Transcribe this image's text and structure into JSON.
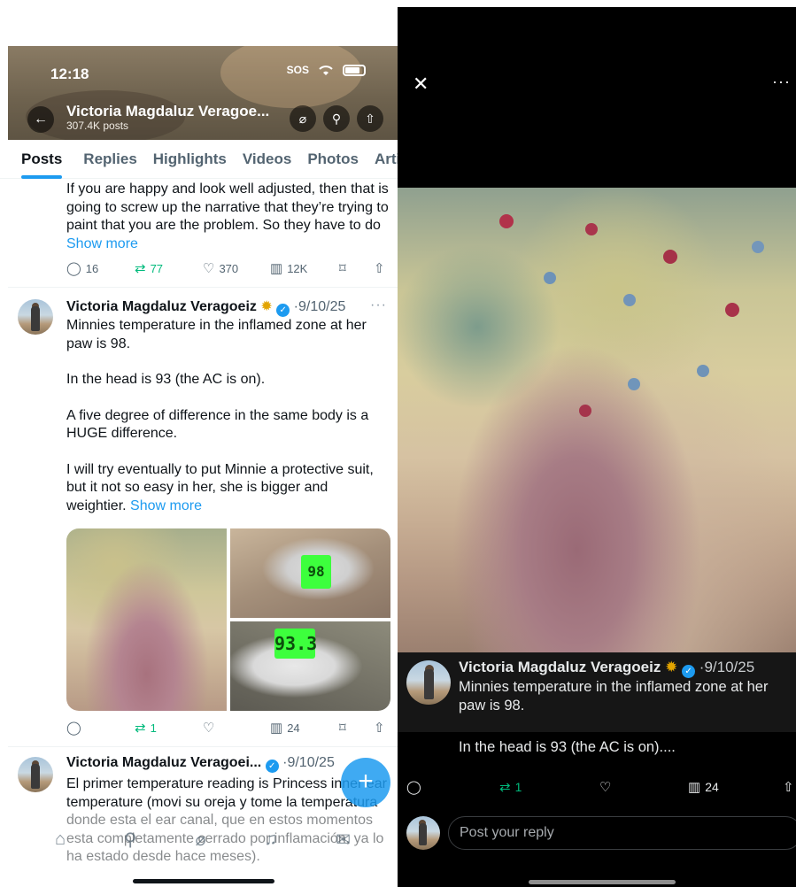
{
  "left": {
    "status": {
      "time": "12:18",
      "sos": "SOS"
    },
    "profile": {
      "name": "Victoria Magdaluz Veragoe...",
      "posts_count": "307.4K posts"
    },
    "tabs": [
      "Posts",
      "Replies",
      "Highlights",
      "Videos",
      "Photos",
      "Artic"
    ],
    "post1": {
      "text": "If you are happy and look well adjusted, then that is going to screw up the narrative that they’re trying to paint that you are the problem. So they have to do",
      "show_more": "Show more",
      "replies": "16",
      "reposts": "77",
      "likes": "370",
      "views": "12K"
    },
    "post2": {
      "name": "Victoria Magdaluz Veragoeiz",
      "date": "9/10/25",
      "p1": "Minnies temperature in the inflamed zone at her paw is 98.",
      "p2": "In the head is 93 (the AC is on).",
      "p3": "A five degree of difference in the same body is a HUGE difference.",
      "p4": "I will try eventually to put Minnie a protective suit, but it not so easy in her, she is bigger and weightier.",
      "show_more": "Show more",
      "lcd_top": "98",
      "lcd_bottom": "93.3",
      "reposts": "1",
      "views": "24"
    },
    "post3": {
      "name": "Victoria Magdaluz Veragoei...",
      "date": "9/10/25",
      "text": "El primer temperature reading is Princess inner ear temperature (movi su oreja y tome la temperatura donde esta el ear canal, que en estos momentos esta completamente cerrado por inflamación, ya lo ha estado desde hace meses)."
    }
  },
  "right": {
    "name": "Victoria Magdaluz Veragoeiz",
    "date": "9/10/25",
    "text1": "Minnies temperature in the inflamed zone at her paw is 98.",
    "text2": "In the head is 93 (the AC is on)....",
    "reposts": "1",
    "views": "24",
    "reply_placeholder": "Post your reply"
  },
  "colors": {
    "accent": "#1d9bf0",
    "repost": "#00ba7c",
    "dark_bg": "#000000"
  },
  "icons": [
    "back-arrow-icon",
    "grok-icon",
    "search-icon",
    "share-icon",
    "reply-icon",
    "repost-icon",
    "like-icon",
    "views-icon",
    "bookmark-icon",
    "verified-icon",
    "sunflower-icon",
    "close-icon",
    "more-icon",
    "home-icon",
    "compose-icon",
    "notifications-icon",
    "messages-icon"
  ]
}
